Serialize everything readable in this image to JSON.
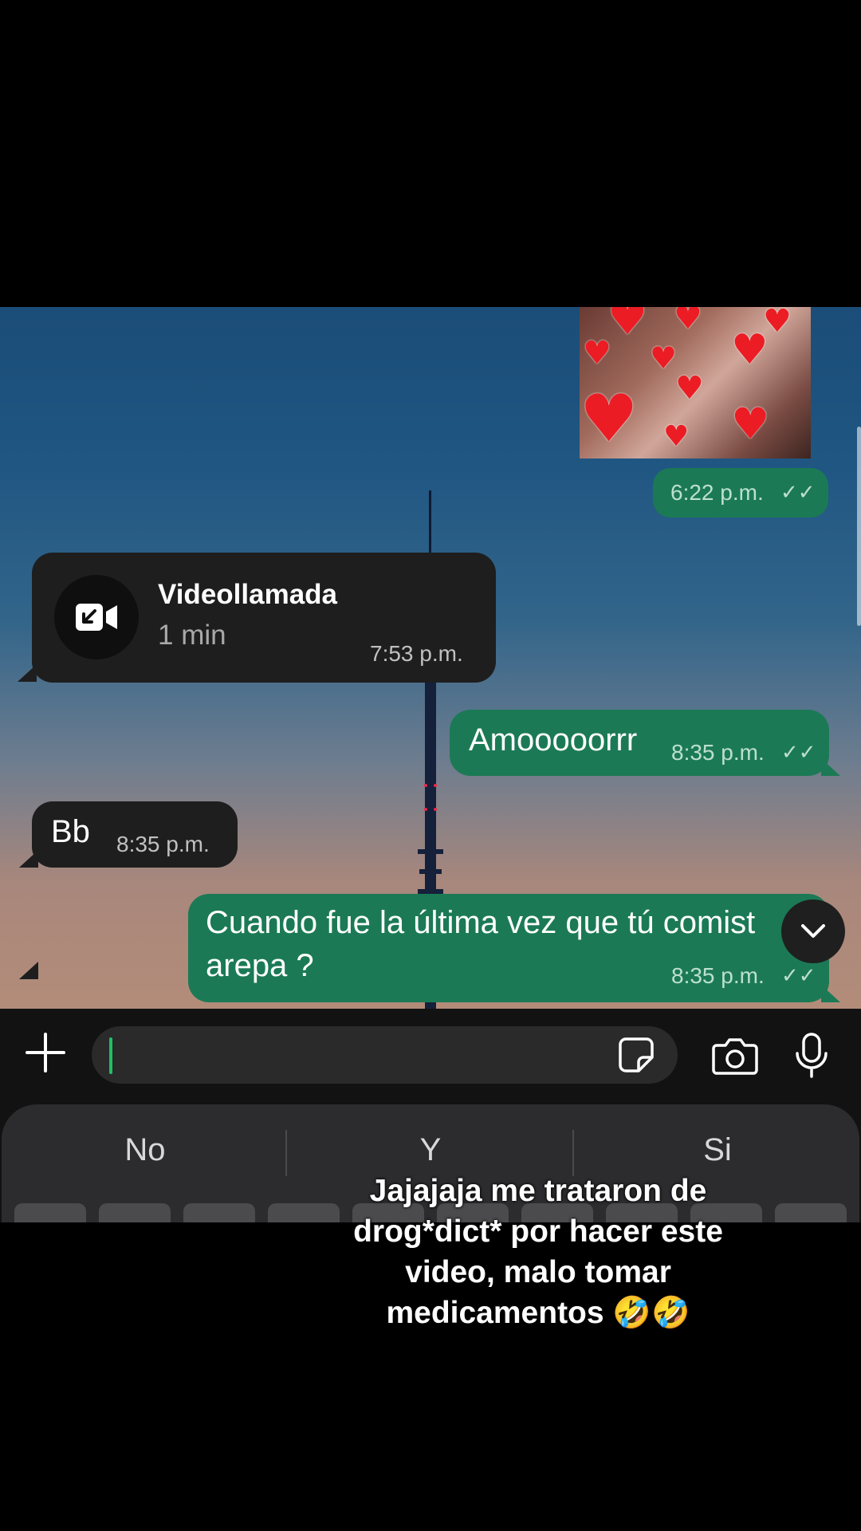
{
  "chat": {
    "image_message": {
      "time": "6:22 p.m.",
      "status": "read"
    },
    "video_call": {
      "title": "Videollamada",
      "duration": "1 min",
      "time": "7:53 p.m."
    },
    "messages": [
      {
        "direction": "outgoing",
        "text": "Amooooorrr",
        "time": "8:35 p.m.",
        "status": "read"
      },
      {
        "direction": "incoming",
        "text": "Bb",
        "time": "8:35 p.m."
      },
      {
        "direction": "outgoing",
        "line1": "Cuando fue la última vez que tú comist",
        "line2": "arepa ?",
        "time": "8:35 p.m.",
        "status": "read"
      }
    ],
    "read_ticks": "✓✓"
  },
  "composer": {
    "placeholder": "",
    "value": ""
  },
  "keyboard": {
    "suggestions": [
      "No",
      "Y",
      "Si"
    ]
  },
  "caption": {
    "lines": [
      "Jajajaja me trataron de",
      "drog*dict* por hacer este",
      "video, malo tomar",
      "medicamentos 🤣🤣"
    ]
  },
  "colors": {
    "incoming_bubble": "#1e1e1e",
    "outgoing_bubble": "#1b7a55",
    "cursor": "#21c063",
    "hearts": "#ec1c24"
  },
  "icons": [
    "video-call-icon",
    "read-ticks-icon",
    "plus-icon",
    "sticker-icon",
    "camera-icon",
    "mic-icon",
    "chevron-down-icon"
  ]
}
